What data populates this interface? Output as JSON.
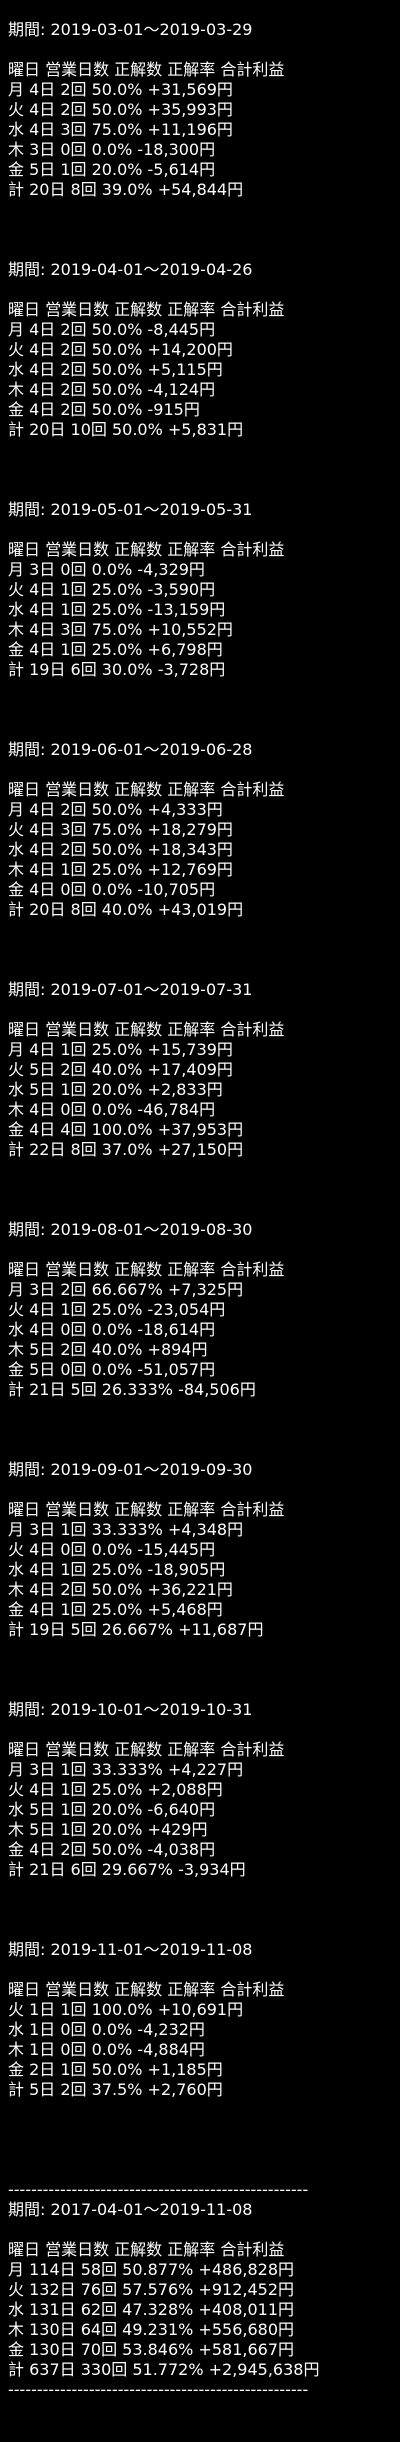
{
  "periods": [
    {
      "period": "期間: 2019-03-01～2019-03-29",
      "header": "曜日 営業日数 正解数 正解率 合計利益",
      "rows": [
        "月 4日 2回 50.0% +31,569円",
        "火 4日 2回 50.0% +35,993円",
        "水 4日 3回 75.0% +11,196円",
        "木 3日 0回 0.0% -18,300円",
        "金 5日 1回 20.0% -5,614円",
        "計 20日 8回 39.0% +54,844円"
      ]
    },
    {
      "period": "期間: 2019-04-01～2019-04-26",
      "header": "曜日 営業日数 正解数 正解率 合計利益",
      "rows": [
        "月 4日 2回 50.0% -8,445円",
        "火 4日 2回 50.0% +14,200円",
        "水 4日 2回 50.0% +5,115円",
        "木 4日 2回 50.0% -4,124円",
        "金 4日 2回 50.0% -915円",
        "計 20日 10回 50.0% +5,831円"
      ]
    },
    {
      "period": "期間: 2019-05-01～2019-05-31",
      "header": "曜日 営業日数 正解数 正解率 合計利益",
      "rows": [
        "月 3日 0回 0.0% -4,329円",
        "火 4日 1回 25.0% -3,590円",
        "水 4日 1回 25.0% -13,159円",
        "木 4日 3回 75.0% +10,552円",
        "金 4日 1回 25.0% +6,798円",
        "計 19日 6回 30.0% -3,728円"
      ]
    },
    {
      "period": "期間: 2019-06-01～2019-06-28",
      "header": "曜日 営業日数 正解数 正解率 合計利益",
      "rows": [
        "月 4日 2回 50.0% +4,333円",
        "火 4日 3回 75.0% +18,279円",
        "水 4日 2回 50.0% +18,343円",
        "木 4日 1回 25.0% +12,769円",
        "金 4日 0回 0.0% -10,705円",
        "計 20日 8回 40.0% +43,019円"
      ]
    },
    {
      "period": "期間: 2019-07-01～2019-07-31",
      "header": "曜日 営業日数 正解数 正解率 合計利益",
      "rows": [
        "月 4日 1回 25.0% +15,739円",
        "火 5日 2回 40.0% +17,409円",
        "水 5日 1回 20.0% +2,833円",
        "木 4日 0回 0.0% -46,784円",
        "金 4日 4回 100.0% +37,953円",
        "計 22日 8回 37.0% +27,150円"
      ]
    },
    {
      "period": "期間: 2019-08-01～2019-08-30",
      "header": "曜日 営業日数 正解数 正解率 合計利益",
      "rows": [
        "月 3日 2回 66.667% +7,325円",
        "火 4日 1回 25.0% -23,054円",
        "水 4日 0回 0.0% -18,614円",
        "木 5日 2回 40.0% +894円",
        "金 5日 0回 0.0% -51,057円",
        "計 21日 5回 26.333% -84,506円"
      ]
    },
    {
      "period": "期間: 2019-09-01～2019-09-30",
      "header": "曜日 営業日数 正解数 正解率 合計利益",
      "rows": [
        "月 3日 1回 33.333% +4,348円",
        "火 4日 0回 0.0% -15,445円",
        "水 4日 1回 25.0% -18,905円",
        "木 4日 2回 50.0% +36,221円",
        "金 4日 1回 25.0% +5,468円",
        "計 19日 5回 26.667% +11,687円"
      ]
    },
    {
      "period": "期間: 2019-10-01～2019-10-31",
      "header": "曜日 営業日数 正解数 正解率 合計利益",
      "rows": [
        "月 3日 1回 33.333% +4,227円",
        "火 4日 1回 25.0% +2,088円",
        "水 5日 1回 20.0% -6,640円",
        "木 5日 1回 20.0% +429円",
        "金 4日 2回 50.0% -4,038円",
        "計 21日 6回 29.667% -3,934円"
      ]
    },
    {
      "period": "期間: 2019-11-01～2019-11-08",
      "header": "曜日 営業日数 正解数 正解率 合計利益",
      "rows": [
        "火 1日 1回 100.0% +10,691円",
        "水 1日 0回 0.0% -4,232円",
        "木 1日 0回 0.0% -4,884円",
        "金 2日 1回 50.0% +1,185円",
        "計 5日 2回 37.5% +2,760円"
      ]
    }
  ],
  "separator": "----------------------------------------------------",
  "summary": {
    "period": "期間: 2017-04-01～2019-11-08",
    "header": "曜日 営業日数 正解数 正解率 合計利益",
    "rows": [
      "月 114日 58回 50.877% +486,828円",
      "火 132日 76回 57.576% +912,452円",
      "水 131日 62回 47.328% +408,011円",
      "木 130日 64回 49.231% +556,680円",
      "金 130日 70回 53.846% +581,667円",
      "計 637日 330回 51.772% +2,945,638円"
    ]
  }
}
